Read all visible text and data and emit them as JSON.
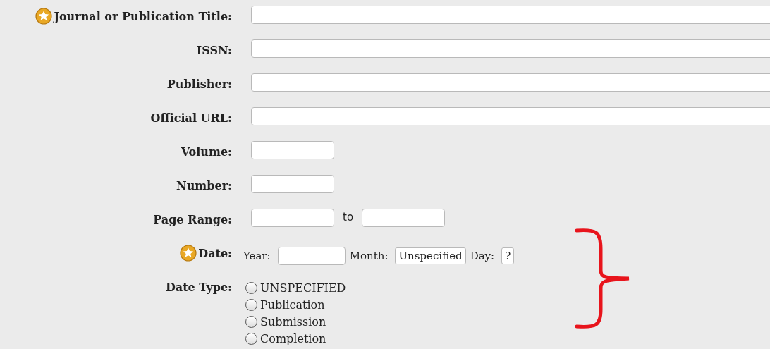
{
  "fields": [
    {
      "kind": "wide",
      "label": "Journal or Publication Title:",
      "required": true
    },
    {
      "kind": "wide",
      "label": "ISSN:",
      "required": false
    },
    {
      "kind": "wide",
      "label": "Publisher:",
      "required": false
    },
    {
      "kind": "wide",
      "label": "Official URL:",
      "required": false
    },
    {
      "kind": "short",
      "label": "Volume:",
      "required": false
    },
    {
      "kind": "short",
      "label": "Number:",
      "required": false
    },
    {
      "kind": "range",
      "label": "Page Range:",
      "required": false,
      "joiner": "to"
    },
    {
      "kind": "date",
      "label": "Date:",
      "required": true,
      "year_label": "Year:",
      "month_label": "Month:",
      "month_value": "Unspecified",
      "day_label": "Day:",
      "day_value": "?"
    },
    {
      "kind": "radio",
      "label": "Date Type:",
      "required": false,
      "options": [
        {
          "label": "UNSPECIFIED",
          "selected": false
        },
        {
          "label": "Publication",
          "selected": false
        },
        {
          "label": "Submission",
          "selected": false
        },
        {
          "label": "Completion",
          "selected": false
        }
      ]
    }
  ]
}
